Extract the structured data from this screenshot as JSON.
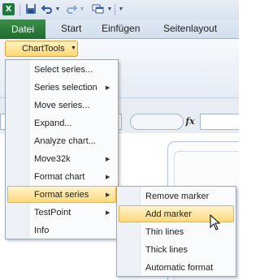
{
  "app": {
    "icon_letter": "X"
  },
  "ribbon_tabs": {
    "file": "Datei",
    "items": [
      "Start",
      "Einfügen",
      "Seitenlayout"
    ]
  },
  "chart_tools_button": {
    "label": "ChartTools"
  },
  "formula_bar": {
    "fx_label": "fx"
  },
  "chart_tools_menu": {
    "items": [
      {
        "label": "Select series...",
        "submenu": false
      },
      {
        "label": "Series selection",
        "submenu": true
      },
      {
        "label": "Move series...",
        "submenu": false
      },
      {
        "label": "Expand...",
        "submenu": false
      },
      {
        "label": "Analyze chart...",
        "submenu": false
      },
      {
        "label": "Move32k",
        "submenu": true
      },
      {
        "label": "Format chart",
        "submenu": true
      },
      {
        "label": "Format series",
        "submenu": true,
        "highlighted": true
      },
      {
        "label": "TestPoint",
        "submenu": true
      },
      {
        "label": "Info",
        "submenu": false
      }
    ]
  },
  "format_series_menu": {
    "items": [
      {
        "label": "Remove marker"
      },
      {
        "label": "Add marker",
        "highlighted": true
      },
      {
        "label": "Thin lines"
      },
      {
        "label": "Thick lines"
      },
      {
        "label": "Automatic format"
      }
    ]
  },
  "colors": {
    "file_tab": "#2a7a3a",
    "highlight": "#ffd978",
    "menu_border": "#9aa8bc"
  }
}
